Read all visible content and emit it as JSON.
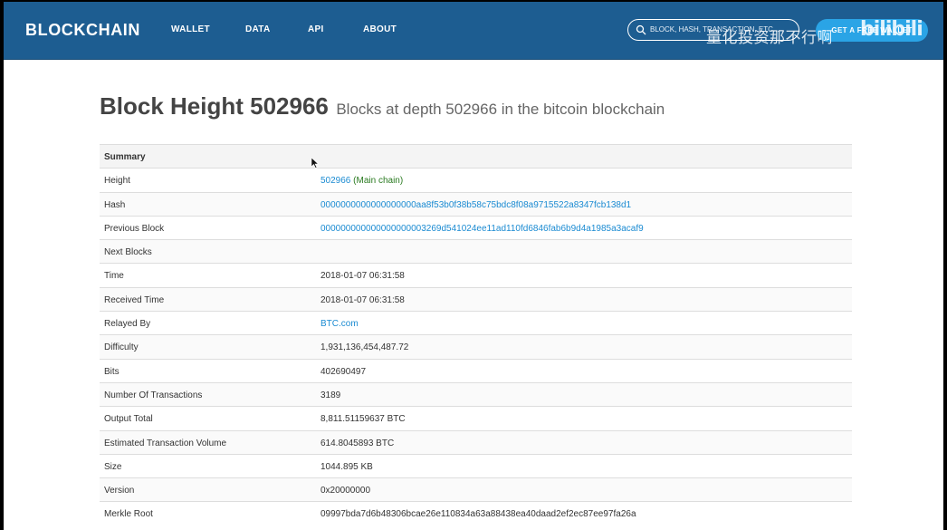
{
  "nav": {
    "brand": "BLOCKCHAIN",
    "links": [
      "WALLET",
      "DATA",
      "API",
      "ABOUT"
    ],
    "search_placeholder": "BLOCK, HASH, TRANSACTION, ETC...",
    "cta_label": "GET A FREE WALLET",
    "watermark": "量化投资那不行啊",
    "bili_logo": "bilibili"
  },
  "heading": {
    "title": "Block Height 502966",
    "subtitle": "Blocks at depth 502966 in the bitcoin blockchain"
  },
  "summary": {
    "header": "Summary",
    "rows": [
      {
        "label": "Height",
        "value": "502966",
        "extra": "(Main chain)"
      },
      {
        "label": "Hash",
        "value": "0000000000000000000aa8f53b0f38b58c75bdc8f08a9715522a8347fcb138d1"
      },
      {
        "label": "Previous Block",
        "value": "000000000000000000003269d541024ee11ad110fd6846fab6b9d4a1985a3acaf9"
      },
      {
        "label": "Next Blocks",
        "value": ""
      },
      {
        "label": "Time",
        "value": "2018-01-07 06:31:58"
      },
      {
        "label": "Received Time",
        "value": "2018-01-07 06:31:58"
      },
      {
        "label": "Relayed By",
        "value": "BTC.com"
      },
      {
        "label": "Difficulty",
        "value": "1,931,136,454,487.72"
      },
      {
        "label": "Bits",
        "value": "402690497"
      },
      {
        "label": "Number Of Transactions",
        "value": "3189"
      },
      {
        "label": "Output Total",
        "value": "8,811.51159637 BTC"
      },
      {
        "label": "Estimated Transaction Volume",
        "value": "614.8045893 BTC"
      },
      {
        "label": "Size",
        "value": "1044.895 KB"
      },
      {
        "label": "Version",
        "value": "0x20000000"
      },
      {
        "label": "Merkle Root",
        "value": "09997bda7d6b48306bcae26e110834a63a88438ea40daad2ef2ec87ee97fa26a"
      }
    ]
  },
  "colors": {
    "navbar": "#1d5d91",
    "cta": "#2aa4e6",
    "link": "#1b8bd2",
    "main_chain": "#2a7a20"
  }
}
